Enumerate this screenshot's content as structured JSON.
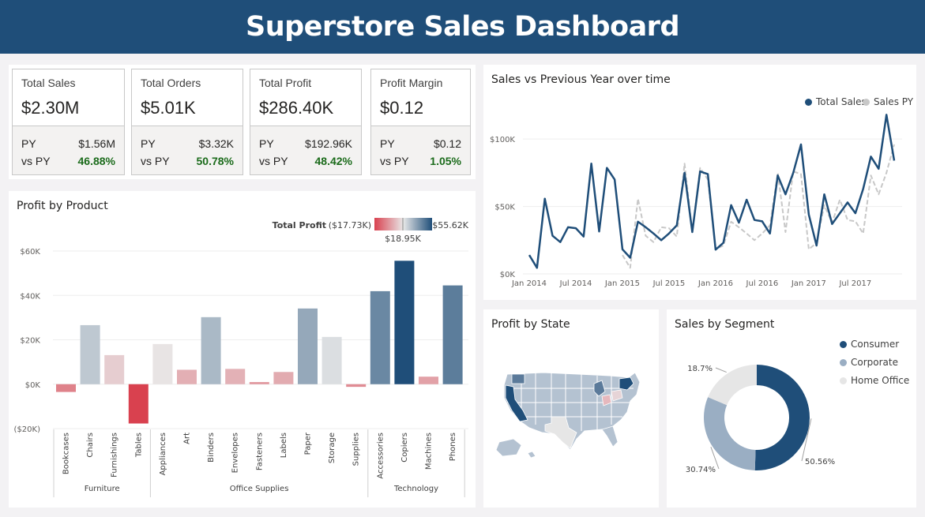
{
  "title": "Superstore Sales Dashboard",
  "kpis": [
    {
      "label": "Total Sales",
      "value": "$2.30M",
      "py_label": "PY",
      "py_value": "$1.56M",
      "vs_label": "vs PY",
      "vs_value": "46.88%"
    },
    {
      "label": "Total Orders",
      "value": "$5.01K",
      "py_label": "PY",
      "py_value": "$3.32K",
      "vs_label": "vs PY",
      "vs_value": "50.78%"
    },
    {
      "label": "Total Profit",
      "value": "$286.40K",
      "py_label": "PY",
      "py_value": "$192.96K",
      "vs_label": "vs PY",
      "vs_value": "48.42%"
    },
    {
      "label": "Profit Margin",
      "value": "$0.12",
      "py_label": "PY",
      "py_value": "$0.12",
      "vs_label": "vs PY",
      "vs_value": "1.05%"
    }
  ],
  "colors": {
    "header": "#1f4e79",
    "navy": "#1f4e79",
    "red": "#d9414f",
    "gray_py": "#c8c8c8",
    "positive": "#1b6b1b"
  },
  "product_chart": {
    "title": "Profit by Product",
    "legend_title": "Total Profit",
    "legend_min": "($17.73K)",
    "legend_mid": "$18.95K",
    "legend_max": "$55.62K"
  },
  "line_chart": {
    "title": "Sales vs Previous Year over time",
    "legend": [
      "Total Sales",
      "Sales PY"
    ]
  },
  "map": {
    "title": "Profit by State"
  },
  "segment": {
    "title": "Sales by Segment"
  },
  "chart_data": [
    {
      "type": "bar",
      "title": "Profit by Product",
      "ylim": [
        -20000,
        60000
      ],
      "yticks": [
        "$60K",
        "$40K",
        "$20K",
        "$0K",
        "($20K)"
      ],
      "groups": [
        {
          "name": "Furniture",
          "categories": [
            "Bookcases",
            "Chairs",
            "Furnishings",
            "Tables"
          ],
          "values": [
            -3500,
            26600,
            13100,
            -17700
          ]
        },
        {
          "name": "Office Supplies",
          "categories": [
            "Appliances",
            "Art",
            "Binders",
            "Envelopes",
            "Fasteners",
            "Labels",
            "Paper",
            "Storage",
            "Supplies"
          ],
          "values": [
            18100,
            6500,
            30200,
            6900,
            950,
            5500,
            34100,
            21300,
            -1200
          ]
        },
        {
          "name": "Technology",
          "categories": [
            "Accessories",
            "Copiers",
            "Machines",
            "Phones"
          ],
          "values": [
            41900,
            55600,
            3400,
            44500
          ]
        }
      ]
    },
    {
      "type": "line",
      "title": "Sales vs Previous Year over time",
      "ylim": [
        0,
        120000
      ],
      "yticks": [
        "$100K",
        "$50K",
        "$0K"
      ],
      "xticks": [
        "Jan 2014",
        "Jul 2014",
        "Jan 2015",
        "Jul 2015",
        "Jan 2016",
        "Jul 2016",
        "Jan 2017",
        "Jul 2017"
      ],
      "series": [
        {
          "name": "Total Sales",
          "values": [
            14000,
            4500,
            55700,
            28300,
            23600,
            34600,
            33900,
            27700,
            81800,
            31500,
            78600,
            70000,
            18200,
            12000,
            38700,
            34600,
            30000,
            25000,
            30000,
            36000,
            75000,
            31000,
            76000,
            74000,
            18000,
            23000,
            51000,
            38000,
            55000,
            40000,
            39000,
            30000,
            73000,
            59000,
            75000,
            96000,
            44000,
            21000,
            59000,
            37000,
            45000,
            53000,
            45000,
            63000,
            87000,
            78000,
            118000,
            84000
          ]
        },
        {
          "name": "Sales PY",
          "values": [
            null,
            null,
            null,
            null,
            null,
            null,
            null,
            null,
            null,
            null,
            null,
            null,
            14000,
            4500,
            55700,
            28300,
            23600,
            34600,
            33900,
            27700,
            81800,
            31500,
            78600,
            70000,
            18200,
            21000,
            38700,
            34600,
            30000,
            25000,
            30000,
            36000,
            75000,
            31000,
            76000,
            74000,
            18200,
            23000,
            51000,
            38000,
            55000,
            40000,
            39000,
            30000,
            73000,
            59000,
            75000,
            96000
          ]
        }
      ]
    },
    {
      "type": "pie",
      "title": "Sales by Segment",
      "labels": [
        "Consumer",
        "Corporate",
        "Home Office"
      ],
      "values": [
        50.56,
        30.74,
        18.7
      ],
      "value_labels": [
        "50.56%",
        "30.74%",
        "18.7%"
      ],
      "colors": [
        "#1f4e79",
        "#9aaec3",
        "#e6e6e6"
      ]
    }
  ]
}
